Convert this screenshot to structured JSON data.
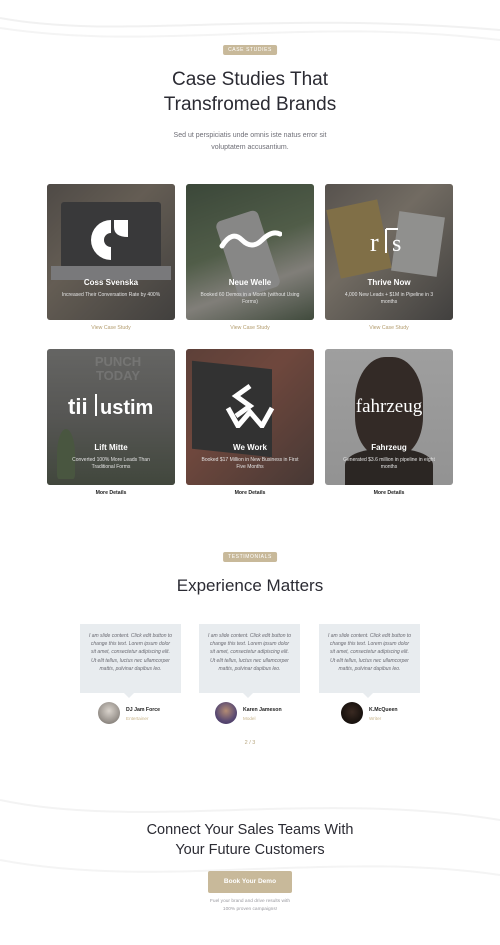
{
  "case_studies": {
    "tag": "CASE STUDIES",
    "title_line1": "Case Studies That",
    "title_line2": "Transfromed Brands",
    "sub_line1": "Sed ut perspiciatis unde omnis iste natus error sit",
    "sub_line2": "voluptatem accusantium.",
    "cards": [
      {
        "logo": "c",
        "title": "Coss Svenska",
        "desc": "Increased Their Conversation Rate by 400%",
        "link": "View Case Study"
      },
      {
        "logo": "wave",
        "title": "Neue Welle",
        "desc": "Booked 60 Demos in a Month (without Using Forms)",
        "link": "View Case Study"
      },
      {
        "logo": "r|s",
        "title": "Thrive Now",
        "desc": "4,000 New Leads + $1M in Pipeline in 3 months",
        "link": "View Case Study"
      },
      {
        "logo": "tiilustim",
        "title": "Lift Mitte",
        "desc": "Converted 100% More Leads Than Traditional Forms",
        "link": "More Details"
      },
      {
        "logo": "ws",
        "title": "We Work",
        "desc": "Booked $17 Million in New Business in First Five Months",
        "link": "More Details"
      },
      {
        "logo": "fahrzeug",
        "title": "Fahrzeug",
        "desc": "Generated $3.6 million in pipeline in eight months",
        "link": "More Details"
      }
    ]
  },
  "testimonials": {
    "tag": "TESTIMONIALS",
    "title": "Experience Matters",
    "items": [
      {
        "text": "I am slide content. Click edit button to change this text. Lorem ipsum dolor sit amet, consectetur adipiscing elit. Ut elit tellus, luctus nec ullamcorper mattis, pulvinar dapibus leo.",
        "name": "DJ Jam Force",
        "role": "Entertainer"
      },
      {
        "text": "I am slide content. Click edit button to change this text. Lorem ipsum dolor sit amet, consectetur adipiscing elit. Ut elit tellus, luctus nec ullamcorper mattis, pulvinar dapibus leo.",
        "name": "Karen Jameson",
        "role": "Model"
      },
      {
        "text": "I am slide content. Click edit button to change this text. Lorem ipsum dolor sit amet, consectetur adipiscing elit. Ut elit tellus, luctus nec ullamcorper mattis, pulvinar dapibus leo.",
        "name": "K.McQueen",
        "role": "Writer"
      }
    ],
    "pager": "2 / 3"
  },
  "cta": {
    "title_line1": "Connect Your Sales Teams With",
    "title_line2": "Your Future Customers",
    "button": "Book Your Demo",
    "note_line1": "Fuel your brand and drive results with",
    "note_line2": "100% proven campaigns!"
  },
  "colors": {
    "accent": "#c8b99a",
    "link_gold": "#b39c6e",
    "card_overlay": "#464646",
    "testimonial_bg": "#e8ecef"
  }
}
